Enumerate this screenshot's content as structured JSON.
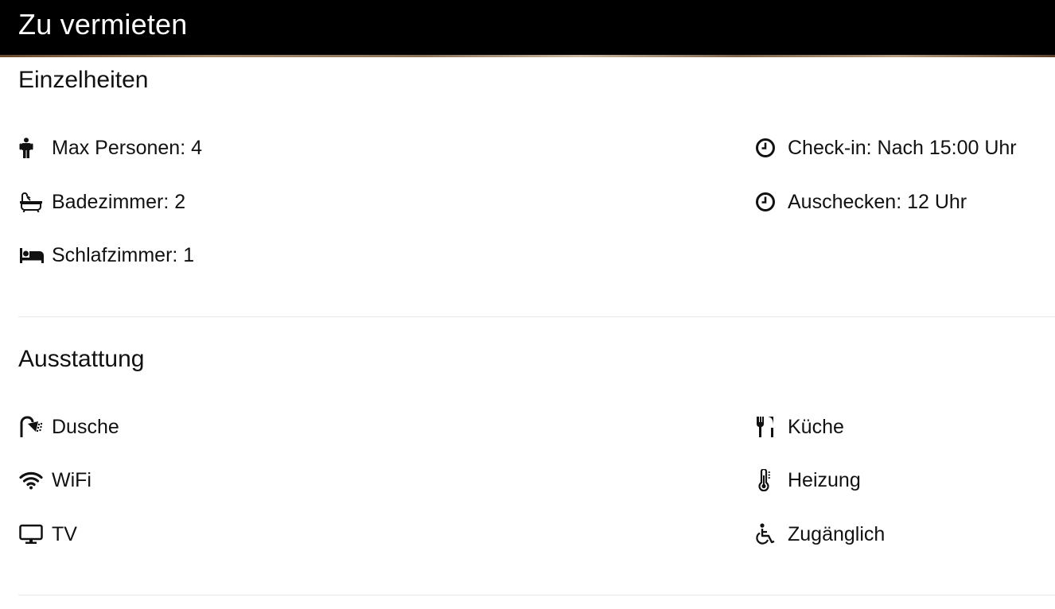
{
  "header": {
    "title": "Zu vermieten"
  },
  "details": {
    "heading": "Einzelheiten",
    "left": [
      {
        "icon": "person-icon",
        "label": "Max Personen: 4"
      },
      {
        "icon": "bathtub-icon",
        "label": "Badezimmer: 2"
      },
      {
        "icon": "bed-icon",
        "label": "Schlafzimmer: 1"
      }
    ],
    "right": [
      {
        "icon": "clock-icon",
        "label": "Check-in: Nach 15:00 Uhr"
      },
      {
        "icon": "clock-icon",
        "label": "Auschecken: 12 Uhr"
      }
    ]
  },
  "amenities": {
    "heading": "Ausstattung",
    "left": [
      {
        "icon": "shower-icon",
        "label": "Dusche"
      },
      {
        "icon": "wifi-icon",
        "label": "WiFi"
      },
      {
        "icon": "tv-icon",
        "label": "TV"
      }
    ],
    "right": [
      {
        "icon": "utensils-icon",
        "label": "Küche"
      },
      {
        "icon": "thermometer-icon",
        "label": "Heizung"
      },
      {
        "icon": "wheelchair-icon",
        "label": "Zugänglich"
      }
    ]
  },
  "colors": {
    "header_bg": "#000000",
    "header_text": "#ffffff",
    "text": "#111111",
    "divider": "#e6e6e6"
  }
}
